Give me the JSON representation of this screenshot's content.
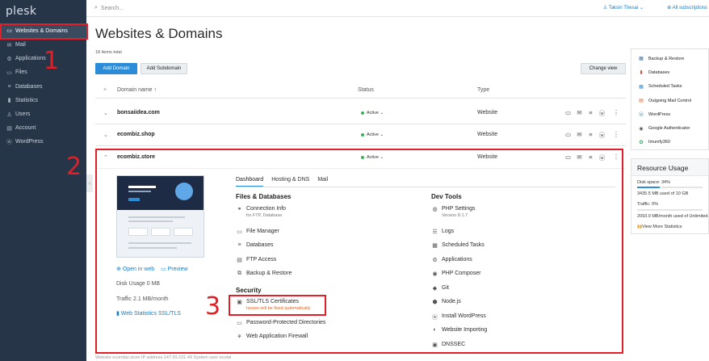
{
  "brand": "plesk",
  "sidebar": {
    "items": [
      {
        "label": "Websites & Domains",
        "icon": "monitor-icon",
        "glyph": "▭"
      },
      {
        "label": "Mail",
        "icon": "mail-icon",
        "glyph": "✉"
      },
      {
        "label": "Applications",
        "icon": "gear-icon",
        "glyph": "⚙"
      },
      {
        "label": "Files",
        "icon": "folder-icon",
        "glyph": "▭"
      },
      {
        "label": "Databases",
        "icon": "database-icon",
        "glyph": "≡"
      },
      {
        "label": "Statistics",
        "icon": "bar-chart-icon",
        "glyph": "▮"
      },
      {
        "label": "Users",
        "icon": "user-icon",
        "glyph": "♙"
      },
      {
        "label": "Account",
        "icon": "account-icon",
        "glyph": "▤"
      },
      {
        "label": "WordPress",
        "icon": "wordpress-icon",
        "glyph": "ⓦ"
      }
    ]
  },
  "annotations": [
    "1",
    "2",
    "3"
  ],
  "topbar": {
    "search_placeholder": "Search...",
    "user": "Taksin Thesai ⌄",
    "subscriptions": "All subscriptions"
  },
  "main": {
    "title": "Websites & Domains",
    "items_total": "18 items total",
    "add_domain": "Add Domain",
    "add_subdomain": "Add Subdomain",
    "change_view": "Change view",
    "columns": {
      "name": "Domain name ↑",
      "status": "Status",
      "type": "Type"
    },
    "rows": [
      {
        "name": "bonsaiidea.com",
        "status": "Active ⌄",
        "type": "Website",
        "chev": "⌄"
      },
      {
        "name": "ecombiz.shop",
        "status": "Active ⌄",
        "type": "Website",
        "chev": "⌄"
      },
      {
        "name": "ecombiz.store",
        "status": "Active ⌄",
        "type": "Website",
        "chev": "⌃"
      }
    ]
  },
  "expanded": {
    "open_in_web": "Open in web",
    "preview": "Preview",
    "disk_usage": "Disk Usage 0 MB",
    "traffic": "Traffic 2.1 MB/month",
    "web_stats": "Web Statistics SSL/TLS",
    "tabs": [
      "Dashboard",
      "Hosting & DNS",
      "Mail"
    ],
    "files_db_title": "Files & Databases",
    "files_db": [
      {
        "label": "Connection Info",
        "sub": "for FTP, Database",
        "icon": "connection-icon",
        "glyph": "⚭"
      },
      {
        "label": "File Manager",
        "icon": "folder-icon",
        "glyph": "▭"
      },
      {
        "label": "Databases",
        "icon": "database-icon",
        "glyph": "≡"
      },
      {
        "label": "FTP Access",
        "icon": "ftp-icon",
        "glyph": "▤"
      },
      {
        "label": "Backup & Restore",
        "icon": "backup-icon",
        "glyph": "⧉"
      }
    ],
    "security_title": "Security",
    "ssl_label": "SSL/TLS Certificates",
    "ssl_warning": "Issues will be fixed automatically",
    "security": [
      {
        "label": "Password-Protected Directories",
        "icon": "lock-folder-icon",
        "glyph": "▭"
      },
      {
        "label": "Web Application Firewall",
        "icon": "firewall-icon",
        "glyph": "⚘"
      }
    ],
    "dev_title": "Dev Tools",
    "php_label": "PHP Settings",
    "php_version": "Version 8.1.7",
    "dev": [
      {
        "label": "Logs",
        "icon": "logs-icon",
        "glyph": "☰"
      },
      {
        "label": "Scheduled Tasks",
        "icon": "calendar-icon",
        "glyph": "▦"
      },
      {
        "label": "Applications",
        "icon": "gear-icon",
        "glyph": "⚙"
      },
      {
        "label": "PHP Composer",
        "icon": "composer-icon",
        "glyph": "◉"
      },
      {
        "label": "Git",
        "icon": "git-icon",
        "glyph": "◆"
      },
      {
        "label": "Node.js",
        "icon": "nodejs-icon",
        "glyph": "⬢"
      },
      {
        "label": "Install WordPress",
        "icon": "wordpress-icon",
        "glyph": "ⓦ"
      },
      {
        "label": "Website Importing",
        "icon": "import-icon",
        "glyph": "◐"
      },
      {
        "label": "DNSSEC",
        "icon": "dnssec-icon",
        "glyph": "▣"
      }
    ]
  },
  "right_panel": {
    "items": [
      {
        "label": "Backup & Restore",
        "icon": "backup-icon",
        "glyph": "▦",
        "color": "#3b6fa8"
      },
      {
        "label": "Databases",
        "icon": "database-icon",
        "glyph": "▮",
        "color": "#d9534f"
      },
      {
        "label": "Scheduled Tasks",
        "icon": "calendar-icon",
        "glyph": "▦",
        "color": "#2b8dd8"
      },
      {
        "label": "Outgoing Mail Control",
        "icon": "mail-control-icon",
        "glyph": "▤",
        "color": "#e0662a"
      },
      {
        "label": "WordPress",
        "icon": "wordpress-icon",
        "glyph": "ⓦ",
        "color": "#21759b"
      },
      {
        "label": "Google Authenticator",
        "icon": "authenticator-icon",
        "glyph": "◉",
        "color": "#555"
      },
      {
        "label": "Imunify360",
        "icon": "imunify-icon",
        "glyph": "✪",
        "color": "#2c9d5a"
      }
    ],
    "resource_title": "Resource Usage",
    "disk_space": "Disk space: 34%",
    "disk_fraction": 0.34,
    "disk_detail": "3435.5 MB used of 10 GB",
    "traffic": "Traffic: 0%",
    "traffic_fraction": 0.0,
    "traffic_detail": "2093.9 MB/month used of Unlimited",
    "view_more": "View More Statistics"
  },
  "footer_strip": "Website ecombiz.store   IP address 147.93.231.49   System user ecotal",
  "colors": {
    "sidebar": "#273548",
    "accent": "#2b8dd8",
    "active": "#3dad58",
    "annotation": "#e21f26"
  }
}
